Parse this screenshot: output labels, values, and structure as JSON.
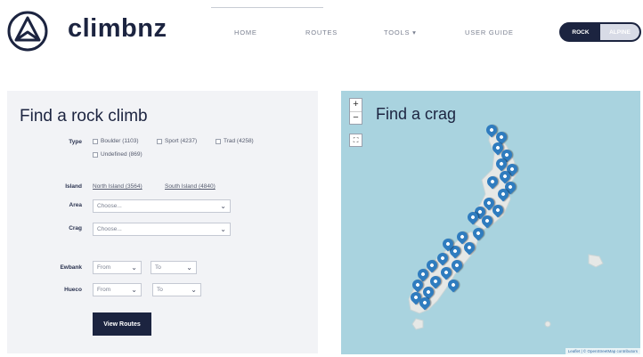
{
  "header": {
    "brand": "climbnz",
    "nav": [
      {
        "label": "HOME"
      },
      {
        "label": "ROUTES"
      },
      {
        "label": "TOOLS ▾"
      },
      {
        "label": "USER GUIDE"
      }
    ],
    "mode_toggle": {
      "active": "ROCK",
      "inactive": "ALPINE"
    }
  },
  "search": {
    "title": "Find a rock climb",
    "type_label": "Type",
    "types": [
      {
        "label": "Boulder (1103)"
      },
      {
        "label": "Sport (4237)"
      },
      {
        "label": "Trad (4258)"
      },
      {
        "label": "Undefined (869)"
      }
    ],
    "island_label": "Island",
    "islands": [
      {
        "label": "North Island (3564)"
      },
      {
        "label": "South Island (4840)"
      }
    ],
    "area_label": "Area",
    "area_placeholder": "Choose...",
    "crag_label": "Crag",
    "crag_placeholder": "Choose...",
    "ewbank_label": "Ewbank",
    "hueco_label": "Hueco",
    "from_label": "From",
    "to_label": "To",
    "submit_label": "View Routes"
  },
  "map": {
    "title": "Find a crag",
    "zoom_in": "+",
    "zoom_out": "−",
    "fullscreen_icon": "⛶",
    "attribution": "Leaflet | © OpenStreetMap contributors",
    "pin_color": "#2f7cbf"
  },
  "colors": {
    "navy": "#1c2440",
    "sea": "#a9d3df",
    "land": "#e6e8e6",
    "panel": "#f2f3f6"
  }
}
